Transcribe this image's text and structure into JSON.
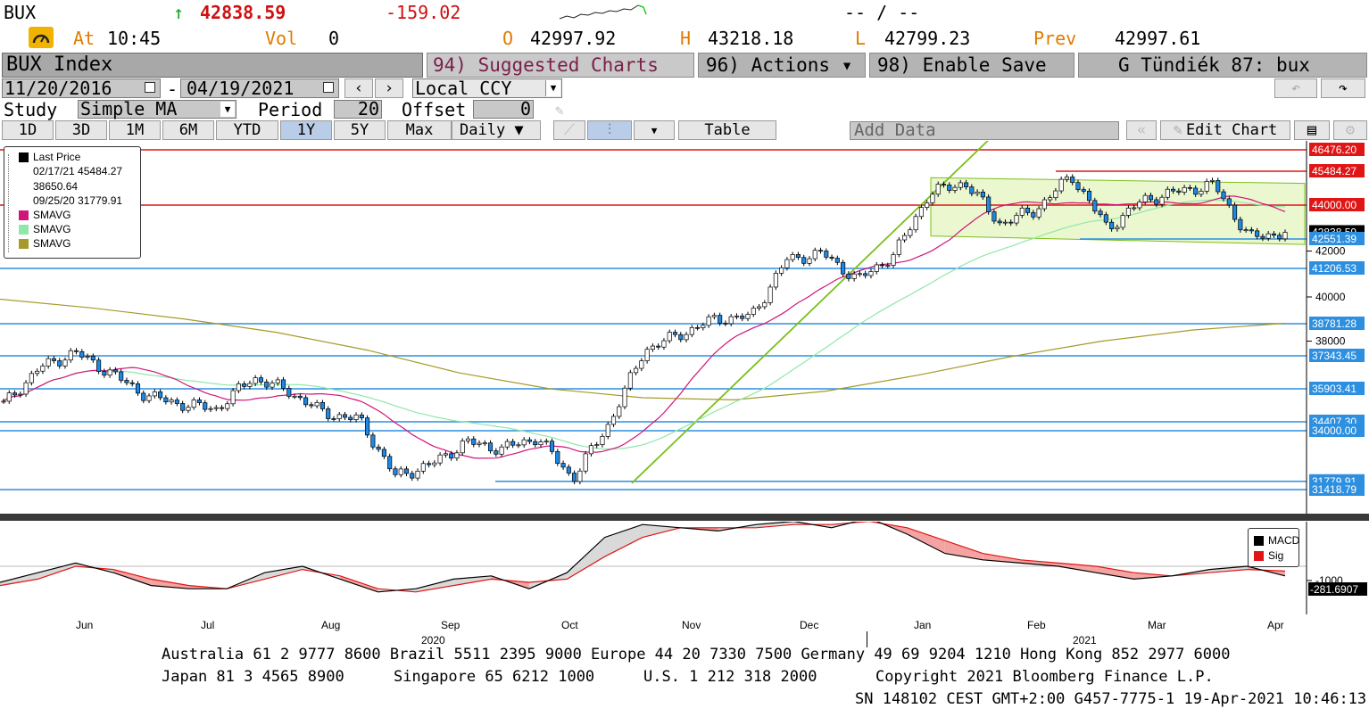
{
  "quote": {
    "ticker": "BUX",
    "arrow": "↑",
    "last": "42838.59",
    "change": "-159.02",
    "at_label": "At",
    "time": "10:45",
    "vol_label": "Vol",
    "vol": "0",
    "open_label": "O",
    "open": "42997.92",
    "high_label": "H",
    "high": "43218.18",
    "low_label": "L",
    "low": "42799.23",
    "prev_label": "Prev",
    "prev": "42997.61",
    "extra": "-- / --"
  },
  "menu": {
    "security": "BUX Index",
    "suggested": "94) Suggested Charts",
    "actions": "96) Actions ▾",
    "enable_save": "98) Enable Save",
    "chart_name": "G Tündiék 87: bux"
  },
  "controls": {
    "date_from": "11/20/2016",
    "date_sep": "-",
    "date_to": "04/19/2021",
    "currency": "Local CCY",
    "study_label": "Study",
    "study": "Simple MA",
    "period_label": "Period",
    "period": "20",
    "offset_label": "Offset",
    "offset": "0"
  },
  "toolbar": {
    "ranges": [
      "1D",
      "3D",
      "1M",
      "6M",
      "YTD",
      "1Y",
      "5Y",
      "Max"
    ],
    "selected_range": "1Y",
    "frequency": "Daily ▼",
    "table": "Table",
    "add_data": "Add Data",
    "edit_chart": "Edit Chart"
  },
  "legend": {
    "last_price": "Last Price",
    "hi": "02/17/21 45484.27",
    "mid": "38650.64",
    "lo": "09/25/20 31779.91",
    "ma1": "SMAVG",
    "ma2": "SMAVG",
    "ma3": "SMAVG"
  },
  "macd_legend": {
    "macd": "MACD",
    "sig": "Sig"
  },
  "footer": {
    "line1": "Australia 61 2 9777 8600 Brazil 5511 2395 9000 Europe 44 20 7330 7500 Germany 49 69 9204 1210 Hong Kong 852 2977 6000",
    "line2a": "Japan 81 3 4565 8900",
    "line2b": "Singapore 65 6212 1000",
    "line2c": "U.S. 1 212 318 2000",
    "line2d": "Copyright 2021 Bloomberg Finance L.P.",
    "line3": "SN 148102 CEST GMT+2:00 G457-7775-1 19-Apr-2021 10:46:13"
  },
  "colors": {
    "up": "#ffffff",
    "down": "#1e88e5",
    "hline_red": "#e01515",
    "hline_blue": "#2d8fe0",
    "trend_green": "#7ac01a",
    "sma_pink": "#d0157a",
    "sma_light": "#8fe8a8",
    "sma_olive": "#a59a2a"
  },
  "chart_data": {
    "type": "candlestick",
    "instrument": "BUX Index",
    "frequency": "Daily",
    "ylim": [
      31000,
      47000
    ],
    "y_ticks": [
      38000,
      40000,
      42000
    ],
    "x_month_labels": [
      "Jun",
      "Jul",
      "Aug",
      "Sep",
      "Oct",
      "Nov",
      "Dec",
      "Jan",
      "Feb",
      "Mar",
      "Apr"
    ],
    "year_labels": [
      "2020",
      "2021"
    ],
    "level_lines": [
      {
        "label": "46476.20",
        "value": 46476.2,
        "color": "red"
      },
      {
        "label": "45484.27",
        "value": 45484.27,
        "color": "red"
      },
      {
        "label": "44000.00",
        "value": 44000.0,
        "color": "red"
      },
      {
        "label": "42838.59",
        "value": 42838.59,
        "color": "white"
      },
      {
        "label": "42551.39",
        "value": 42551.39,
        "color": "blue"
      },
      {
        "label": "41206.53",
        "value": 41206.53,
        "color": "blue"
      },
      {
        "label": "38781.28",
        "value": 38781.28,
        "color": "blue"
      },
      {
        "label": "37343.45",
        "value": 37343.45,
        "color": "blue"
      },
      {
        "label": "35903.41",
        "value": 35903.41,
        "color": "blue"
      },
      {
        "label": "34407.30",
        "value": 34407.3,
        "color": "blue"
      },
      {
        "label": "34000.00",
        "value": 34000.0,
        "color": "blue"
      },
      {
        "label": "31779.91",
        "value": 31779.91,
        "color": "blue"
      },
      {
        "label": "31418.79",
        "value": 31418.79,
        "color": "blue"
      }
    ],
    "close_path": [
      {
        "date": "Jun 2020",
        "close": 35200
      },
      {
        "date": "Jun 2020",
        "close": 36800
      },
      {
        "date": "Jun 2020",
        "close": 37500
      },
      {
        "date": "Jul 2020",
        "close": 36600
      },
      {
        "date": "Jul 2020",
        "close": 35600
      },
      {
        "date": "Jul 2020",
        "close": 35200
      },
      {
        "date": "Aug 2020",
        "close": 35000
      },
      {
        "date": "Aug 2020",
        "close": 36400
      },
      {
        "date": "Aug 2020",
        "close": 35800
      },
      {
        "date": "Aug 2020",
        "close": 34800
      },
      {
        "date": "Sep 2020",
        "close": 34500
      },
      {
        "date": "Sep 2020",
        "close": 32000
      },
      {
        "date": "Sep 2020",
        "close": 32500
      },
      {
        "date": "Oct 2020",
        "close": 33500
      },
      {
        "date": "Oct 2020",
        "close": 33200
      },
      {
        "date": "Oct 2020",
        "close": 33700
      },
      {
        "date": "Oct 2020",
        "close": 31900
      },
      {
        "date": "Nov 2020",
        "close": 34300
      },
      {
        "date": "Nov 2020",
        "close": 37600
      },
      {
        "date": "Nov 2020",
        "close": 38300
      },
      {
        "date": "Nov 2020",
        "close": 39000
      },
      {
        "date": "Dec 2020",
        "close": 39100
      },
      {
        "date": "Dec 2020",
        "close": 41600
      },
      {
        "date": "Dec 2020",
        "close": 41900
      },
      {
        "date": "Dec 2020",
        "close": 40700
      },
      {
        "date": "Dec 2020",
        "close": 41800
      },
      {
        "date": "Jan 2021",
        "close": 44500
      },
      {
        "date": "Jan 2021",
        "close": 45000
      },
      {
        "date": "Jan 2021",
        "close": 43200
      },
      {
        "date": "Feb 2021",
        "close": 43800
      },
      {
        "date": "Feb 2021",
        "close": 45300
      },
      {
        "date": "Feb 2021",
        "close": 43000
      },
      {
        "date": "Mar 2021",
        "close": 44200
      },
      {
        "date": "Mar 2021",
        "close": 44600
      },
      {
        "date": "Mar 2021",
        "close": 44900
      },
      {
        "date": "Apr 2021",
        "close": 42600
      },
      {
        "date": "Apr 2021",
        "close": 42838.59
      }
    ],
    "macd_panel": {
      "series": [
        "MACD",
        "Sig"
      ],
      "y_ticks": [
        1000,
        -1000
      ],
      "last_macd": "-281.6907"
    }
  }
}
